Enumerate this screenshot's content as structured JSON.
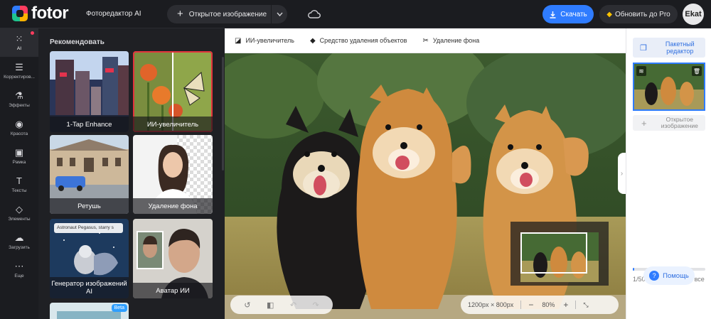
{
  "topbar": {
    "logo": "fotor",
    "app_title": "Фоторедактор AI",
    "open_image": "Открытое изображение",
    "download": "Скачать",
    "upgrade": "Обновить до Pro",
    "avatar_text": "Ekat"
  },
  "toolrail": {
    "items": [
      {
        "label": "AI",
        "icon": "grid-icon"
      },
      {
        "label": "Корректиров...",
        "icon": "sliders-icon"
      },
      {
        "label": "Эффекты",
        "icon": "flask-icon"
      },
      {
        "label": "Красота",
        "icon": "eye-icon"
      },
      {
        "label": "Рамка",
        "icon": "frame-icon"
      },
      {
        "label": "Тексты",
        "icon": "text-icon"
      },
      {
        "label": "Элементы",
        "icon": "shapes-icon"
      },
      {
        "label": "Загрузить",
        "icon": "upload-cloud-icon"
      },
      {
        "label": "Еще",
        "icon": "more-icon"
      }
    ]
  },
  "panel": {
    "title": "Рекомендовать",
    "cards": [
      {
        "label": "1-Tap Enhance"
      },
      {
        "label": "ИИ-увеличитель"
      },
      {
        "label": "Ретушь"
      },
      {
        "label": "Удаление фона"
      },
      {
        "label": "Генератор изображений AI"
      },
      {
        "label": "Аватар ИИ"
      },
      {
        "label": ""
      }
    ],
    "generator_prompt": "Astronaut Pegasus, starry s",
    "beta": "Beta"
  },
  "subbar": {
    "ai_upscaler": "ИИ-увеличитель",
    "object_remover": "Средство удаления объектов",
    "bg_remover": "Удаление фона"
  },
  "canvas": {
    "size": "1200px × 800px",
    "zoom": "80%"
  },
  "rightpanel": {
    "batch": "Пакетный редактор",
    "open_image": "Открытое изображение",
    "count": "1/50",
    "clear": "Очистить все",
    "progress": 0.02
  },
  "help": "Помощь",
  "colors": {
    "accent": "#2f7cff",
    "selected_outline": "#e3333d",
    "pro_icon": "#ffc400"
  }
}
